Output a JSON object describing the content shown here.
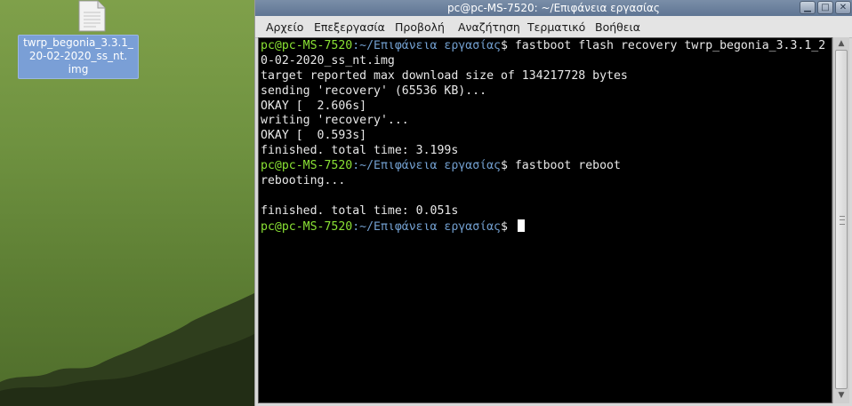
{
  "desktop": {
    "file_icon": {
      "label_lines": [
        "twrp_begonia_3.3.1_",
        "20-02-2020_ss_nt.",
        "img"
      ]
    }
  },
  "window": {
    "title": "pc@pc-MS-7520: ~/Επιφάνεια εργασίας",
    "buttons": [
      "minimize",
      "maximize",
      "close"
    ],
    "menu": [
      "Αρχείο",
      "Επεξεργασία",
      "Προβολή",
      "Αναζήτηση",
      "Τερματικό",
      "Βοήθεια"
    ]
  },
  "terminal": {
    "prompt_user": "pc@pc-MS-7520",
    "prompt_path": ":~/Επιφάνεια εργασίας",
    "prompt_symbol": "$",
    "lines": [
      {
        "type": "prompt",
        "cmd": " fastboot flash recovery twrp_begonia_3.3.1_2"
      },
      {
        "type": "text",
        "text": "0-02-2020_ss_nt.img"
      },
      {
        "type": "text",
        "text": "target reported max download size of 134217728 bytes"
      },
      {
        "type": "text",
        "text": "sending 'recovery' (65536 KB)..."
      },
      {
        "type": "text",
        "text": "OKAY [  2.606s]"
      },
      {
        "type": "text",
        "text": "writing 'recovery'..."
      },
      {
        "type": "text",
        "text": "OKAY [  0.593s]"
      },
      {
        "type": "text",
        "text": "finished. total time: 3.199s"
      },
      {
        "type": "prompt",
        "cmd": " fastboot reboot"
      },
      {
        "type": "text",
        "text": "rebooting..."
      },
      {
        "type": "text",
        "text": ""
      },
      {
        "type": "text",
        "text": "finished. total time: 0.051s"
      },
      {
        "type": "prompt",
        "cmd": " ",
        "cursor": true
      }
    ]
  },
  "colors": {
    "prompt_user": "#8ae234",
    "prompt_path": "#729fcf",
    "terminal_bg": "#000000",
    "terminal_fg": "#e8e8e8"
  }
}
